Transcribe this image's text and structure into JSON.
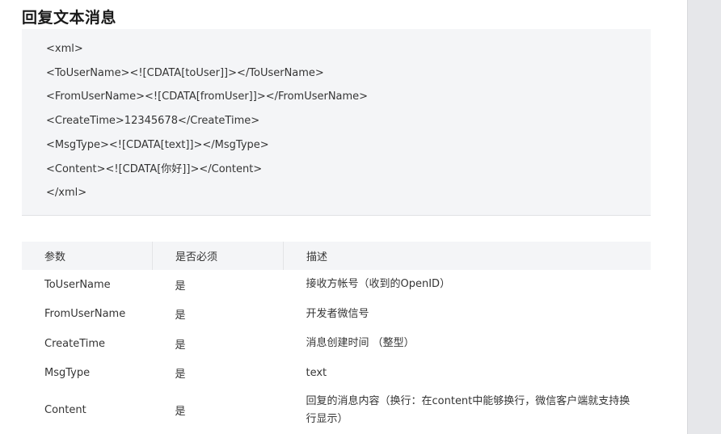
{
  "title": "回复文本消息",
  "code_lines": [
    "<xml>",
    "<ToUserName><![CDATA[toUser]]></ToUserName>",
    "<FromUserName><![CDATA[fromUser]]></FromUserName>",
    "<CreateTime>12345678</CreateTime>",
    "<MsgType><![CDATA[text]]></MsgType>",
    "<Content><![CDATA[你好]]></Content>",
    "</xml>"
  ],
  "table": {
    "headers": [
      "参数",
      "是否必须",
      "描述"
    ],
    "rows": [
      {
        "param": "ToUserName",
        "required": "是",
        "desc": "接收方帐号（收到的OpenID）"
      },
      {
        "param": "FromUserName",
        "required": "是",
        "desc": "开发者微信号"
      },
      {
        "param": "CreateTime",
        "required": "是",
        "desc": "消息创建时间 （整型）"
      },
      {
        "param": "MsgType",
        "required": "是",
        "desc": "text"
      },
      {
        "param": "Content",
        "required": "是",
        "desc": "回复的消息内容（换行：在content中能够换行，微信客户端就支持换行显示）"
      }
    ]
  },
  "colors": {
    "code_bg": "#f4f5f7",
    "gutter": "#e6e7ea",
    "text": "#353535"
  }
}
